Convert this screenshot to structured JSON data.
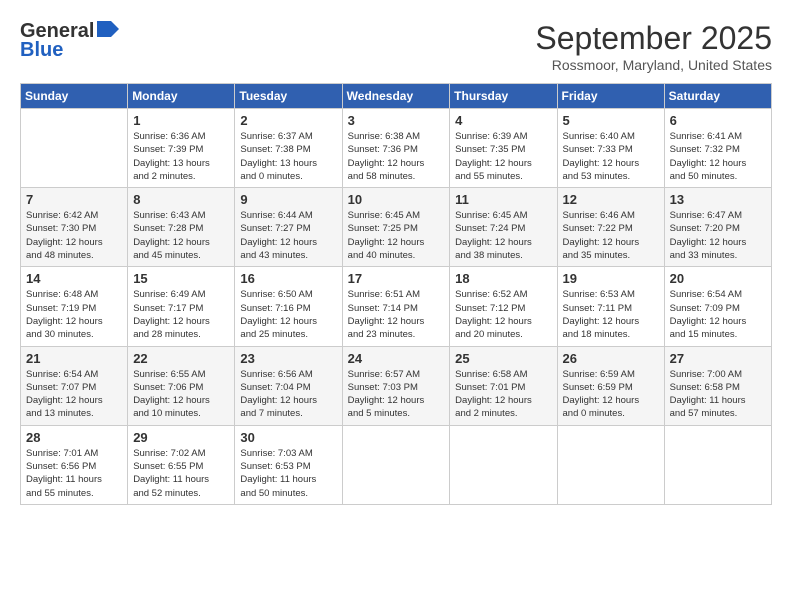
{
  "header": {
    "logo_general": "General",
    "logo_blue": "Blue",
    "month_title": "September 2025",
    "location": "Rossmoor, Maryland, United States"
  },
  "days_of_week": [
    "Sunday",
    "Monday",
    "Tuesday",
    "Wednesday",
    "Thursday",
    "Friday",
    "Saturday"
  ],
  "weeks": [
    [
      {
        "day": "",
        "info": ""
      },
      {
        "day": "1",
        "info": "Sunrise: 6:36 AM\nSunset: 7:39 PM\nDaylight: 13 hours\nand 2 minutes."
      },
      {
        "day": "2",
        "info": "Sunrise: 6:37 AM\nSunset: 7:38 PM\nDaylight: 13 hours\nand 0 minutes."
      },
      {
        "day": "3",
        "info": "Sunrise: 6:38 AM\nSunset: 7:36 PM\nDaylight: 12 hours\nand 58 minutes."
      },
      {
        "day": "4",
        "info": "Sunrise: 6:39 AM\nSunset: 7:35 PM\nDaylight: 12 hours\nand 55 minutes."
      },
      {
        "day": "5",
        "info": "Sunrise: 6:40 AM\nSunset: 7:33 PM\nDaylight: 12 hours\nand 53 minutes."
      },
      {
        "day": "6",
        "info": "Sunrise: 6:41 AM\nSunset: 7:32 PM\nDaylight: 12 hours\nand 50 minutes."
      }
    ],
    [
      {
        "day": "7",
        "info": "Sunrise: 6:42 AM\nSunset: 7:30 PM\nDaylight: 12 hours\nand 48 minutes."
      },
      {
        "day": "8",
        "info": "Sunrise: 6:43 AM\nSunset: 7:28 PM\nDaylight: 12 hours\nand 45 minutes."
      },
      {
        "day": "9",
        "info": "Sunrise: 6:44 AM\nSunset: 7:27 PM\nDaylight: 12 hours\nand 43 minutes."
      },
      {
        "day": "10",
        "info": "Sunrise: 6:45 AM\nSunset: 7:25 PM\nDaylight: 12 hours\nand 40 minutes."
      },
      {
        "day": "11",
        "info": "Sunrise: 6:45 AM\nSunset: 7:24 PM\nDaylight: 12 hours\nand 38 minutes."
      },
      {
        "day": "12",
        "info": "Sunrise: 6:46 AM\nSunset: 7:22 PM\nDaylight: 12 hours\nand 35 minutes."
      },
      {
        "day": "13",
        "info": "Sunrise: 6:47 AM\nSunset: 7:20 PM\nDaylight: 12 hours\nand 33 minutes."
      }
    ],
    [
      {
        "day": "14",
        "info": "Sunrise: 6:48 AM\nSunset: 7:19 PM\nDaylight: 12 hours\nand 30 minutes."
      },
      {
        "day": "15",
        "info": "Sunrise: 6:49 AM\nSunset: 7:17 PM\nDaylight: 12 hours\nand 28 minutes."
      },
      {
        "day": "16",
        "info": "Sunrise: 6:50 AM\nSunset: 7:16 PM\nDaylight: 12 hours\nand 25 minutes."
      },
      {
        "day": "17",
        "info": "Sunrise: 6:51 AM\nSunset: 7:14 PM\nDaylight: 12 hours\nand 23 minutes."
      },
      {
        "day": "18",
        "info": "Sunrise: 6:52 AM\nSunset: 7:12 PM\nDaylight: 12 hours\nand 20 minutes."
      },
      {
        "day": "19",
        "info": "Sunrise: 6:53 AM\nSunset: 7:11 PM\nDaylight: 12 hours\nand 18 minutes."
      },
      {
        "day": "20",
        "info": "Sunrise: 6:54 AM\nSunset: 7:09 PM\nDaylight: 12 hours\nand 15 minutes."
      }
    ],
    [
      {
        "day": "21",
        "info": "Sunrise: 6:54 AM\nSunset: 7:07 PM\nDaylight: 12 hours\nand 13 minutes."
      },
      {
        "day": "22",
        "info": "Sunrise: 6:55 AM\nSunset: 7:06 PM\nDaylight: 12 hours\nand 10 minutes."
      },
      {
        "day": "23",
        "info": "Sunrise: 6:56 AM\nSunset: 7:04 PM\nDaylight: 12 hours\nand 7 minutes."
      },
      {
        "day": "24",
        "info": "Sunrise: 6:57 AM\nSunset: 7:03 PM\nDaylight: 12 hours\nand 5 minutes."
      },
      {
        "day": "25",
        "info": "Sunrise: 6:58 AM\nSunset: 7:01 PM\nDaylight: 12 hours\nand 2 minutes."
      },
      {
        "day": "26",
        "info": "Sunrise: 6:59 AM\nSunset: 6:59 PM\nDaylight: 12 hours\nand 0 minutes."
      },
      {
        "day": "27",
        "info": "Sunrise: 7:00 AM\nSunset: 6:58 PM\nDaylight: 11 hours\nand 57 minutes."
      }
    ],
    [
      {
        "day": "28",
        "info": "Sunrise: 7:01 AM\nSunset: 6:56 PM\nDaylight: 11 hours\nand 55 minutes."
      },
      {
        "day": "29",
        "info": "Sunrise: 7:02 AM\nSunset: 6:55 PM\nDaylight: 11 hours\nand 52 minutes."
      },
      {
        "day": "30",
        "info": "Sunrise: 7:03 AM\nSunset: 6:53 PM\nDaylight: 11 hours\nand 50 minutes."
      },
      {
        "day": "",
        "info": ""
      },
      {
        "day": "",
        "info": ""
      },
      {
        "day": "",
        "info": ""
      },
      {
        "day": "",
        "info": ""
      }
    ]
  ]
}
